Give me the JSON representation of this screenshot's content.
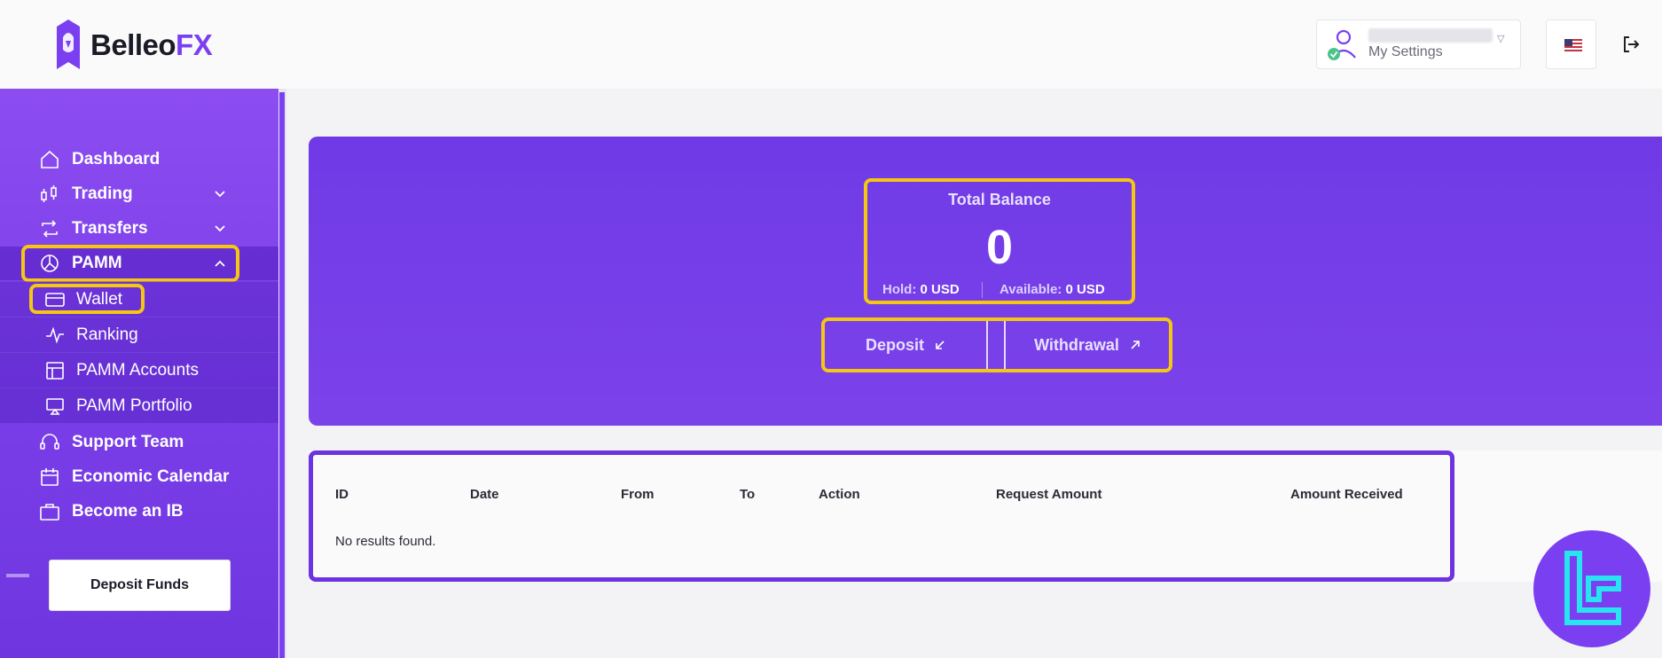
{
  "brand": {
    "name_part1": "Belleo",
    "name_part2": "FX",
    "accent": "#7b3ff2",
    "highlight": "#f5c713"
  },
  "header": {
    "user_settings_label": "My Settings",
    "user_icon": "user-verified-icon",
    "language_flag": "us-flag-icon",
    "logout_icon": "logout-icon"
  },
  "sidebar": {
    "items": [
      {
        "label": "Dashboard",
        "icon": "home-icon"
      },
      {
        "label": "Trading",
        "icon": "candlestick-icon"
      },
      {
        "label": "Transfers",
        "icon": "transfer-icon"
      },
      {
        "label": "PAMM",
        "icon": "pie-chart-icon"
      }
    ],
    "pamm_sub": [
      {
        "label": "Wallet",
        "icon": "wallet-icon"
      },
      {
        "label": "Ranking",
        "icon": "activity-icon"
      },
      {
        "label": "PAMM Accounts",
        "icon": "layout-icon"
      },
      {
        "label": "PAMM Portfolio",
        "icon": "portfolio-icon"
      }
    ],
    "bottom_items": [
      {
        "label": "Support Team",
        "icon": "headset-icon"
      },
      {
        "label": "Economic Calendar",
        "icon": "calendar-icon"
      },
      {
        "label": "Become an IB",
        "icon": "briefcase-icon"
      }
    ],
    "deposit_funds_label": "Deposit Funds"
  },
  "balance": {
    "title": "Total Balance",
    "value": "0",
    "hold_label": "Hold:",
    "hold_value": "0 USD",
    "available_label": "Available:",
    "available_value": "0 USD",
    "deposit_label": "Deposit",
    "withdrawal_label": "Withdrawal"
  },
  "table": {
    "columns": [
      "ID",
      "Date",
      "From",
      "To",
      "Action",
      "Request Amount",
      "Amount Received"
    ],
    "empty_message": "No results found."
  }
}
